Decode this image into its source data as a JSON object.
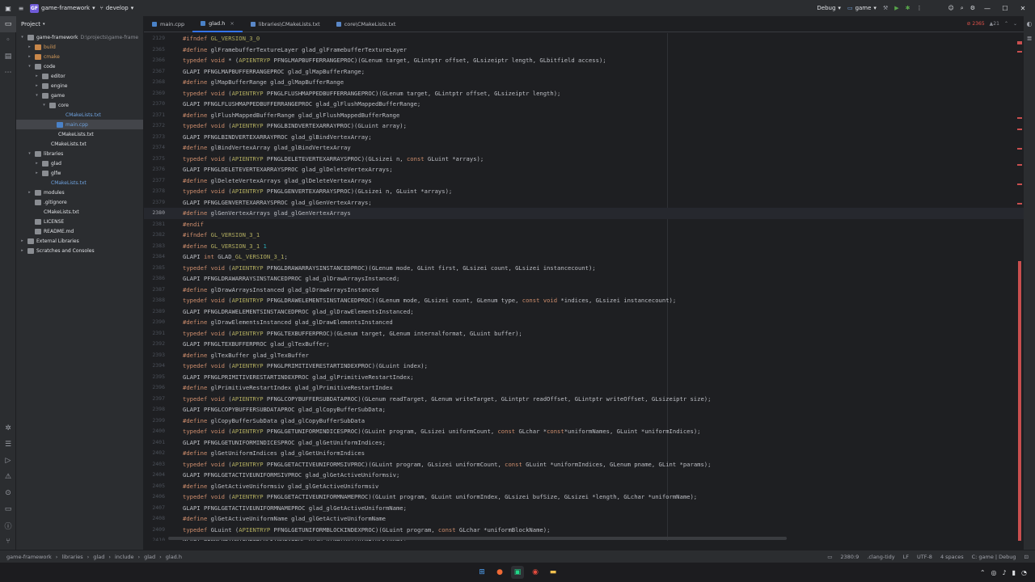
{
  "titlebar": {
    "project_name": "game-framework",
    "project_initials": "GF",
    "branch": "develop",
    "build_config": "Debug",
    "run_target": "game",
    "menu_icon": "hamburger-icon",
    "window_controls": [
      "—",
      "☐",
      "✕"
    ]
  },
  "project_panel": {
    "title": "Project",
    "tree": [
      {
        "depth": 0,
        "name": "game-framework",
        "suffix": "D:\\projects\\game-frame",
        "type": "folder",
        "expanded": true
      },
      {
        "depth": 1,
        "name": "build",
        "type": "folder",
        "color": "orange"
      },
      {
        "depth": 1,
        "name": "cmake",
        "type": "folder",
        "color": "orange"
      },
      {
        "depth": 1,
        "name": "code",
        "type": "folder",
        "expanded": true
      },
      {
        "depth": 2,
        "name": "editor",
        "type": "folder"
      },
      {
        "depth": 2,
        "name": "engine",
        "type": "folder"
      },
      {
        "depth": 2,
        "name": "game",
        "type": "folder",
        "expanded": true
      },
      {
        "depth": 3,
        "name": "core",
        "type": "folder",
        "expanded": true
      },
      {
        "depth": 4,
        "name": "CMakeLists.txt",
        "type": "cmake",
        "color": "blue"
      },
      {
        "depth": 4,
        "name": "main.cpp",
        "type": "cpp",
        "color": "blue",
        "selected": true
      },
      {
        "depth": 3,
        "name": "CMakeLists.txt",
        "type": "cmake"
      },
      {
        "depth": 2,
        "name": "CMakeLists.txt",
        "type": "cmake"
      },
      {
        "depth": 1,
        "name": "libraries",
        "type": "folder",
        "expanded": true
      },
      {
        "depth": 2,
        "name": "glad",
        "type": "folder"
      },
      {
        "depth": 2,
        "name": "glfw",
        "type": "folder"
      },
      {
        "depth": 2,
        "name": "CMakeLists.txt",
        "type": "cmake",
        "color": "blue"
      },
      {
        "depth": 1,
        "name": "modules",
        "type": "folder"
      },
      {
        "depth": 1,
        "name": ".gitignore",
        "type": "txt"
      },
      {
        "depth": 1,
        "name": "CMakeLists.txt",
        "type": "cmake"
      },
      {
        "depth": 1,
        "name": "LICENSE",
        "type": "txt"
      },
      {
        "depth": 1,
        "name": "README.md",
        "type": "txt"
      },
      {
        "depth": 0,
        "name": "External Libraries",
        "type": "folder"
      },
      {
        "depth": 0,
        "name": "Scratches and Consoles",
        "type": "folder"
      }
    ]
  },
  "tabs": [
    {
      "label": "main.cpp",
      "active": false
    },
    {
      "label": "glad.h",
      "active": true
    },
    {
      "label": "libraries\\CMakeLists.txt",
      "active": false
    },
    {
      "label": "core\\CMakeLists.txt",
      "active": false
    }
  ],
  "inspection": {
    "errors": "2365",
    "warnings": "21"
  },
  "code_lines": [
    {
      "n": "2129",
      "t": "#ifndef GL_VERSION_3_0"
    },
    {
      "n": "2365",
      "t": "#define glFramebufferTextureLayer glad_glFramebufferTextureLayer"
    },
    {
      "n": "2366",
      "t": "typedef void * (APIENTRYP PFNGLMAPBUFFERRANGEPROC)(GLenum target, GLintptr offset, GLsizeiptr length, GLbitfield access);"
    },
    {
      "n": "2367",
      "t": "GLAPI PFNGLMAPBUFFERRANGEPROC glad_glMapBufferRange;"
    },
    {
      "n": "2368",
      "t": "#define glMapBufferRange glad_glMapBufferRange"
    },
    {
      "n": "2369",
      "t": "typedef void (APIENTRYP PFNGLFLUSHMAPPEDBUFFERRANGEPROC)(GLenum target, GLintptr offset, GLsizeiptr length);"
    },
    {
      "n": "2370",
      "t": "GLAPI PFNGLFLUSHMAPPEDBUFFERRANGEPROC glad_glFlushMappedBufferRange;"
    },
    {
      "n": "2371",
      "t": "#define glFlushMappedBufferRange glad_glFlushMappedBufferRange"
    },
    {
      "n": "2372",
      "t": "typedef void (APIENTRYP PFNGLBINDVERTEXARRAYPROC)(GLuint array);"
    },
    {
      "n": "2373",
      "t": "GLAPI PFNGLBINDVERTEXARRAYPROC glad_glBindVertexArray;"
    },
    {
      "n": "2374",
      "t": "#define glBindVertexArray glad_glBindVertexArray"
    },
    {
      "n": "2375",
      "t": "typedef void (APIENTRYP PFNGLDELETEVERTEXARRAYSPROC)(GLsizei n, const GLuint *arrays);"
    },
    {
      "n": "2376",
      "t": "GLAPI PFNGLDELETEVERTEXARRAYSPROC glad_glDeleteVertexArrays;"
    },
    {
      "n": "2377",
      "t": "#define glDeleteVertexArrays glad_glDeleteVertexArrays"
    },
    {
      "n": "2378",
      "t": "typedef void (APIENTRYP PFNGLGENVERTEXARRAYSPROC)(GLsizei n, GLuint *arrays);"
    },
    {
      "n": "2379",
      "t": "GLAPI PFNGLGENVERTEXARRAYSPROC glad_glGenVertexArrays;"
    },
    {
      "n": "2380",
      "t": "#define glGenVertexArrays glad_glGenVertexArrays",
      "current": true
    },
    {
      "n": "2381",
      "t": "#endif"
    },
    {
      "n": "2382",
      "t": "#ifndef GL_VERSION_3_1"
    },
    {
      "n": "2383",
      "t": "#define GL_VERSION_3_1 1"
    },
    {
      "n": "2384",
      "t": "GLAPI int GLAD_GL_VERSION_3_1;"
    },
    {
      "n": "2385",
      "t": "typedef void (APIENTRYP PFNGLDRAWARRAYSINSTANCEDPROC)(GLenum mode, GLint first, GLsizei count, GLsizei instancecount);"
    },
    {
      "n": "2386",
      "t": "GLAPI PFNGLDRAWARRAYSINSTANCEDPROC glad_glDrawArraysInstanced;"
    },
    {
      "n": "2387",
      "t": "#define glDrawArraysInstanced glad_glDrawArraysInstanced"
    },
    {
      "n": "2388",
      "t": "typedef void (APIENTRYP PFNGLDRAWELEMENTSINSTANCEDPROC)(GLenum mode, GLsizei count, GLenum type, const void *indices, GLsizei instancecount);"
    },
    {
      "n": "2389",
      "t": "GLAPI PFNGLDRAWELEMENTSINSTANCEDPROC glad_glDrawElementsInstanced;"
    },
    {
      "n": "2390",
      "t": "#define glDrawElementsInstanced glad_glDrawElementsInstanced"
    },
    {
      "n": "2391",
      "t": "typedef void (APIENTRYP PFNGLTEXBUFFERPROC)(GLenum target, GLenum internalformat, GLuint buffer);"
    },
    {
      "n": "2392",
      "t": "GLAPI PFNGLTEXBUFFERPROC glad_glTexBuffer;"
    },
    {
      "n": "2393",
      "t": "#define glTexBuffer glad_glTexBuffer"
    },
    {
      "n": "2394",
      "t": "typedef void (APIENTRYP PFNGLPRIMITIVERESTARTINDEXPROC)(GLuint index);"
    },
    {
      "n": "2395",
      "t": "GLAPI PFNGLPRIMITIVERESTARTINDEXPROC glad_glPrimitiveRestartIndex;"
    },
    {
      "n": "2396",
      "t": "#define glPrimitiveRestartIndex glad_glPrimitiveRestartIndex"
    },
    {
      "n": "2397",
      "t": "typedef void (APIENTRYP PFNGLCOPYBUFFERSUBDATAPROC)(GLenum readTarget, GLenum writeTarget, GLintptr readOffset, GLintptr writeOffset, GLsizeiptr size);"
    },
    {
      "n": "2398",
      "t": "GLAPI PFNGLCOPYBUFFERSUBDATAPROC glad_glCopyBufferSubData;"
    },
    {
      "n": "2399",
      "t": "#define glCopyBufferSubData glad_glCopyBufferSubData"
    },
    {
      "n": "2400",
      "t": "typedef void (APIENTRYP PFNGLGETUNIFORMINDICESPROC)(GLuint program, GLsizei uniformCount, const GLchar *const*uniformNames, GLuint *uniformIndices);"
    },
    {
      "n": "2401",
      "t": "GLAPI PFNGLGETUNIFORMINDICESPROC glad_glGetUniformIndices;"
    },
    {
      "n": "2402",
      "t": "#define glGetUniformIndices glad_glGetUniformIndices"
    },
    {
      "n": "2403",
      "t": "typedef void (APIENTRYP PFNGLGETACTIVEUNIFORMSIVPROC)(GLuint program, GLsizei uniformCount, const GLuint *uniformIndices, GLenum pname, GLint *params);"
    },
    {
      "n": "2404",
      "t": "GLAPI PFNGLGETACTIVEUNIFORMSIVPROC glad_glGetActiveUniformsiv;"
    },
    {
      "n": "2405",
      "t": "#define glGetActiveUniformsiv glad_glGetActiveUniformsiv"
    },
    {
      "n": "2406",
      "t": "typedef void (APIENTRYP PFNGLGETACTIVEUNIFORMNAMEPROC)(GLuint program, GLuint uniformIndex, GLsizei bufSize, GLsizei *length, GLchar *uniformName);"
    },
    {
      "n": "2407",
      "t": "GLAPI PFNGLGETACTIVEUNIFORMNAMEPROC glad_glGetActiveUniformName;"
    },
    {
      "n": "2408",
      "t": "#define glGetActiveUniformName glad_glGetActiveUniformName"
    },
    {
      "n": "2409",
      "t": "typedef GLuint (APIENTRYP PFNGLGETUNIFORMBLOCKINDEXPROC)(GLuint program, const GLchar *uniformBlockName);"
    },
    {
      "n": "2410",
      "t": "GLAPI PFNGLGETUNIFORMBLOCKINDEXPROC glad_glGetUniformBlockIndex;"
    }
  ],
  "statusbar": {
    "breadcrumb": [
      "game-framework",
      "libraries",
      "glad",
      "include",
      "glad",
      "glad.h"
    ],
    "position": "2380:9",
    "lint": ".clang-tidy",
    "line_ending": "LF",
    "encoding": "UTF-8",
    "indent": "4 spaces",
    "context": "C: game | Debug"
  },
  "colors": {
    "keyword": "#cf8e6d",
    "macro": "#b3ae60",
    "number": "#2aacb8",
    "identifier": "#bcbec4",
    "accent": "#3574f0"
  }
}
